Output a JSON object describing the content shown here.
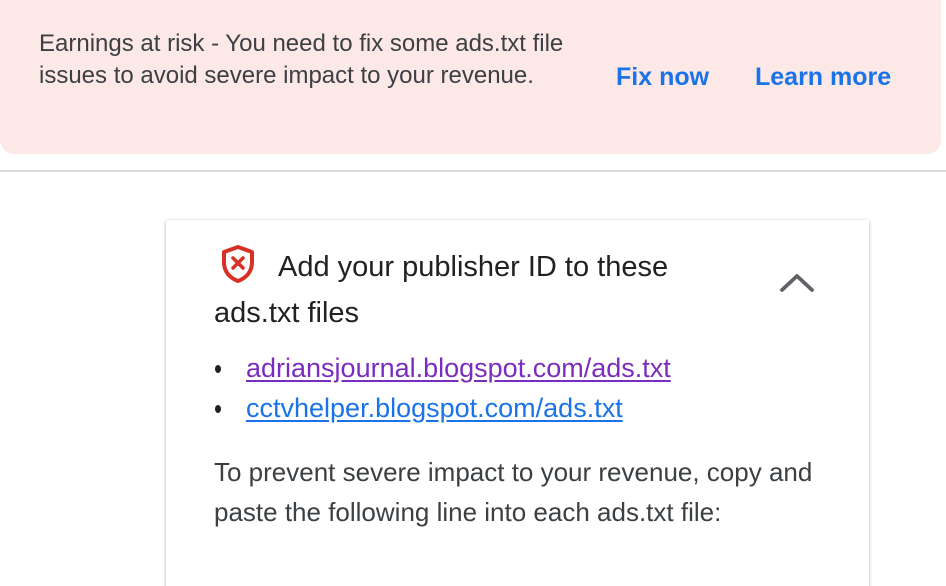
{
  "alert": {
    "message": "Earnings at risk - You need to fix some ads.txt file issues to avoid severe impact to your revenue.",
    "fix_now": "Fix now",
    "learn_more": "Learn more",
    "background_color": "#fce8e6",
    "link_color": "#1a73e8"
  },
  "card": {
    "title": "Add your publisher ID to these ads.txt files",
    "status_icon": "shield-error-icon",
    "status_color": "#d93025",
    "collapse_icon": "chevron-up-icon",
    "files": [
      {
        "url": "adriansjournal.blogspot.com/ads.txt",
        "color": "#7b2cbf"
      },
      {
        "url": "cctvhelper.blogspot.com/ads.txt",
        "color": "#1a73e8"
      }
    ],
    "instruction": "To prevent severe impact to your revenue, copy and paste the following line into each ads.txt file:"
  }
}
